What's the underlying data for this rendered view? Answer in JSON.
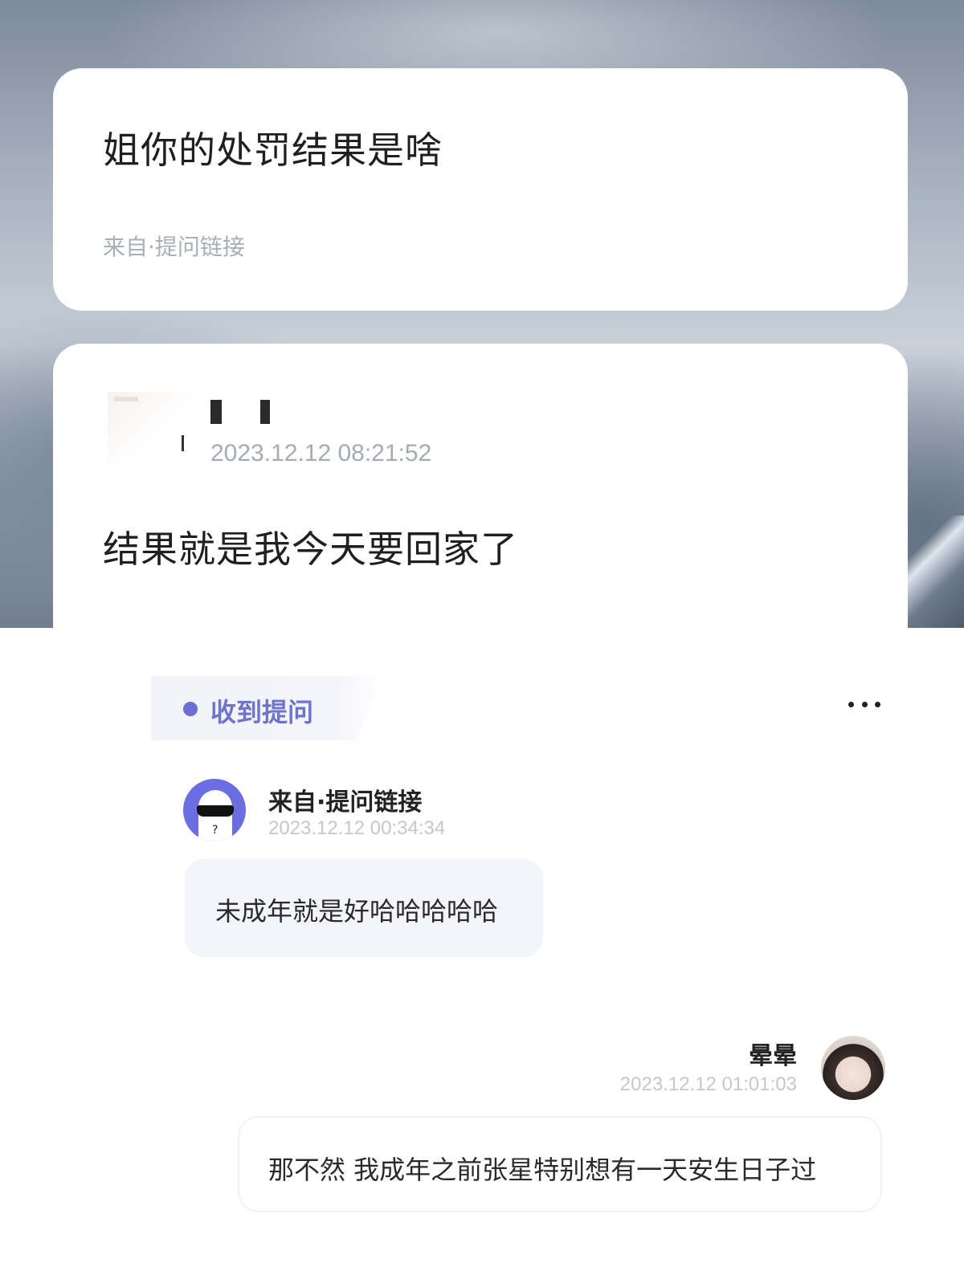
{
  "top": {
    "question": {
      "text": "姐你的处罚结果是啥",
      "source": "来自·提问链接"
    },
    "answer": {
      "time": "2023.12.12 08:21:52",
      "text": "结果就是我今天要回家了"
    }
  },
  "bottom": {
    "tag": {
      "label": "收到提问",
      "dot_color": "#6d6fd6"
    },
    "more_icon": "more-horizontal-icon",
    "asker": {
      "name": "来自·提问链接",
      "time": "2023.12.12 00:34:34",
      "message": "未成年就是好哈哈哈哈哈",
      "avatar_color": "#6a6ee0"
    },
    "reply": {
      "name": "晕晕",
      "time": "2023.12.12 01:01:03",
      "message": "那不然 我成年之前张星特别想有一天安生日子过"
    }
  }
}
